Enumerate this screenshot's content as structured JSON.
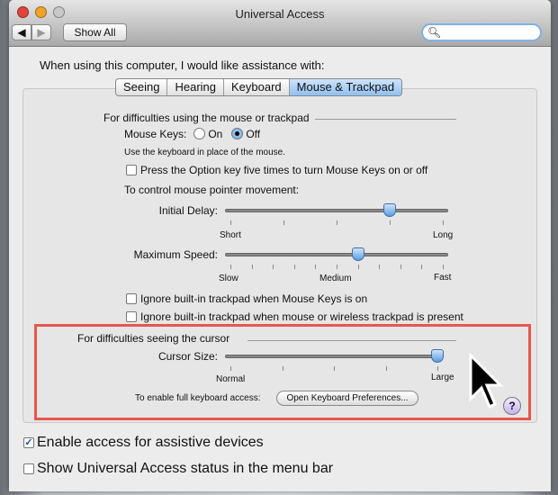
{
  "window": {
    "title": "Universal Access",
    "show_all": "Show All",
    "search_placeholder": ""
  },
  "prompt": "When using this computer, I would like assistance with:",
  "tabs": [
    {
      "label": "Seeing"
    },
    {
      "label": "Hearing"
    },
    {
      "label": "Keyboard"
    },
    {
      "label": "Mouse & Trackpad",
      "active": true
    }
  ],
  "mouse_section": {
    "heading": "For difficulties using the mouse or trackpad",
    "mouse_keys_label": "Mouse Keys:",
    "on_label": "On",
    "off_label": "Off",
    "mouse_keys_value": "Off",
    "hint": "Use the keyboard in place of the mouse.",
    "option_key_label": "Press the Option key five times to turn Mouse Keys on or off",
    "option_key_checked": false,
    "control_label": "To control mouse pointer movement:",
    "initial_delay": {
      "label": "Initial Delay:",
      "min": "Short",
      "max": "Long",
      "value": 0.75
    },
    "max_speed": {
      "label": "Maximum Speed:",
      "min": "Slow",
      "mid": "Medium",
      "max": "Fast",
      "value": 0.6
    },
    "ignore1": "Ignore built-in trackpad when Mouse Keys is on",
    "ignore2": "Ignore built-in trackpad when mouse or wireless trackpad is present"
  },
  "cursor_section": {
    "heading": "For difficulties seeing the cursor",
    "cursor_size": {
      "label": "Cursor Size:",
      "min": "Normal",
      "max": "Large",
      "value": 1.0
    },
    "keyboard_access_label": "To enable full keyboard access:",
    "open_keyboard_prefs": "Open Keyboard Preferences...",
    "help": "?"
  },
  "bottom": {
    "assistive_label": "Enable access for assistive devices",
    "assistive_checked": true,
    "status_label": "Show Universal Access status in the menu bar",
    "status_checked": false
  },
  "colors": {
    "highlight": "#e8564f",
    "accent": "#5c9de0"
  }
}
